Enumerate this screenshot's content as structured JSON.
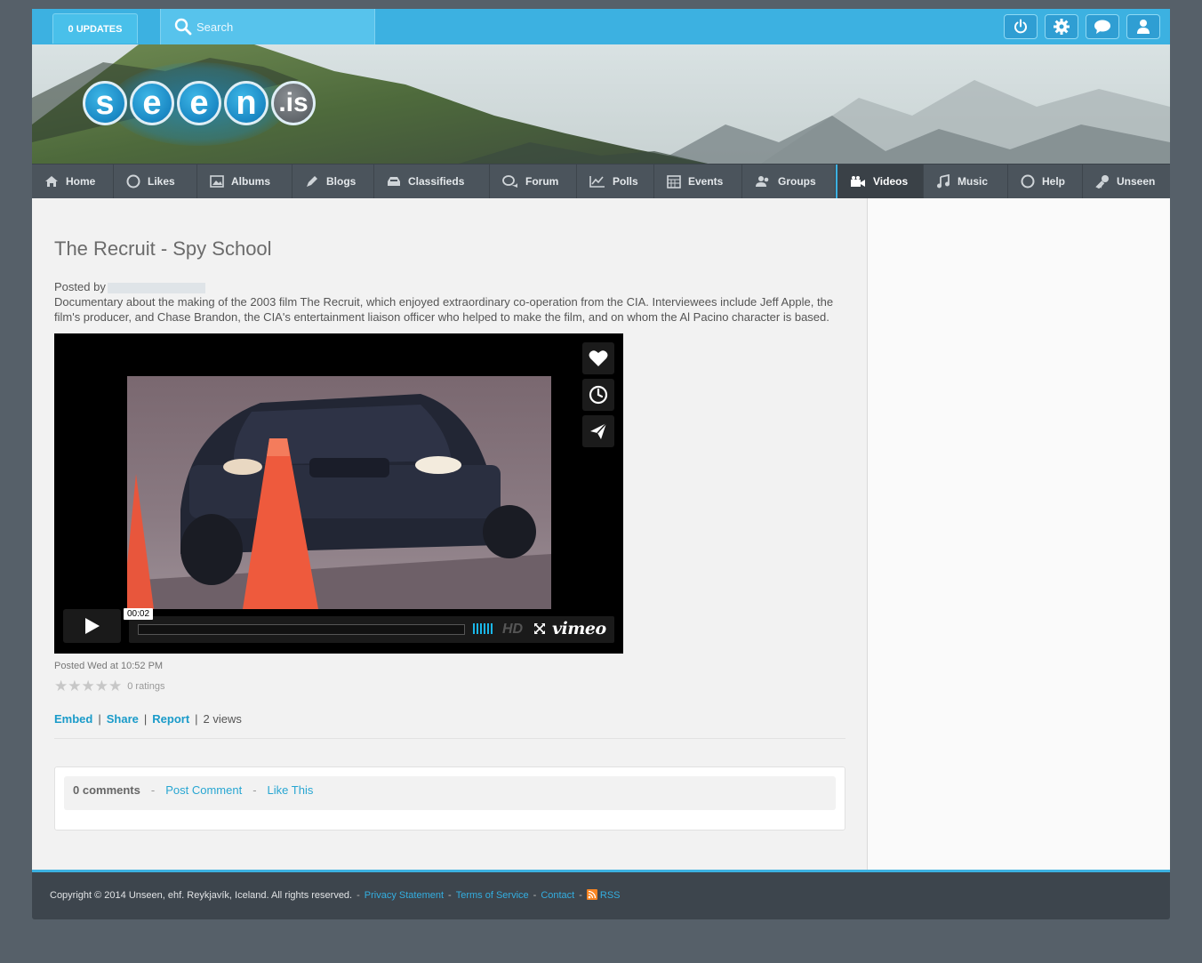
{
  "topbar": {
    "updates_label": "0 UPDATES",
    "search_placeholder": "Search",
    "icons": [
      "power-icon",
      "gear-icon",
      "chat-icon",
      "user-icon"
    ]
  },
  "logo": {
    "letters": [
      "s",
      "e",
      "e",
      "n",
      ".is"
    ]
  },
  "nav": {
    "items": [
      {
        "label": "Home",
        "icon": "home-icon"
      },
      {
        "label": "Likes",
        "icon": "circle-icon"
      },
      {
        "label": "Albums",
        "icon": "image-icon"
      },
      {
        "label": "Blogs",
        "icon": "pen-icon"
      },
      {
        "label": "Classifieds",
        "icon": "tray-icon"
      },
      {
        "label": "Forum",
        "icon": "chat-bubbles-icon"
      },
      {
        "label": "Polls",
        "icon": "chart-icon"
      },
      {
        "label": "Events",
        "icon": "calendar-icon"
      },
      {
        "label": "Groups",
        "icon": "group-icon"
      },
      {
        "label": "Videos",
        "icon": "video-camera-icon",
        "active": true
      },
      {
        "label": "Music",
        "icon": "music-icon"
      },
      {
        "label": "Help",
        "icon": "circle-icon"
      },
      {
        "label": "Unseen",
        "icon": "key-icon"
      }
    ]
  },
  "post": {
    "title": "The Recruit - Spy School",
    "posted_by_label": "Posted by",
    "description": "Documentary about the making of the 2003 film The Recruit, which enjoyed extraordinary co-operation from the CIA. Interviewees include Jeff Apple, the film's producer, and Chase Brandon, the CIA's entertainment liaison officer who helped to make the film, and on whom the Al Pacino character is based.",
    "posted_time": "Posted Wed at 10:52 PM",
    "ratings_text": "0 ratings",
    "rating_value": 0,
    "rating_max": 5
  },
  "video": {
    "timecode": "00:02",
    "hd_label": "HD",
    "brand": "vimeo",
    "side_buttons": [
      "heart-icon",
      "clock-icon",
      "send-icon"
    ],
    "progress": 0
  },
  "actions": {
    "embed": "Embed",
    "share": "Share",
    "report": "Report",
    "views": "2 views",
    "separator": "|"
  },
  "comments": {
    "count": "0 comments",
    "post_comment": "Post Comment",
    "like_this": "Like This",
    "separator": "-"
  },
  "footer": {
    "copyright": "Copyright © 2014 Unseen, ehf. Reykjavík, Iceland. All rights reserved.",
    "privacy": "Privacy Statement",
    "terms": "Terms of Service",
    "contact": "Contact",
    "rss": "RSS",
    "separator": "-"
  },
  "colors": {
    "accent": "#3cb1e1",
    "nav_bg": "#4b545c",
    "link": "#1a9bc9",
    "page_bg": "#566069"
  }
}
